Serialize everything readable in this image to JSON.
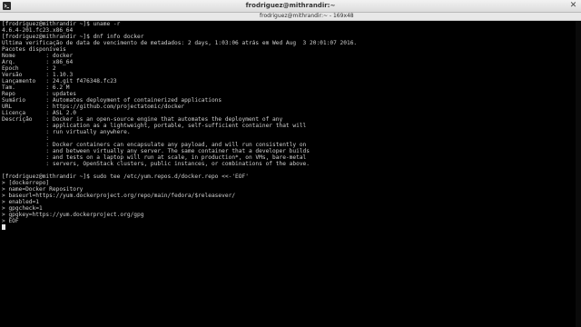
{
  "window": {
    "title": "frodriguez@mithrandir:~",
    "tab_title": "frodriguez@mithrandir:~ - 169x48",
    "close_icon": "close-icon",
    "app_icon": "terminal-icon"
  },
  "terminal": {
    "lines": [
      "[frodriguez@mithrandir ~]$ uname -r",
      "4.6.4-201.fc23.x86_64",
      "[frodriguez@mithrandir ~]$ dnf info docker",
      "Última verificação de data de vencimento de metadados: 2 days, 1:03:06 atrás em Wed Aug  3 20:01:07 2016.",
      "Pacotes disponíveis",
      "Nome         : docker",
      "Arq.         : x86_64",
      "Epoch        : 2",
      "Versão       : 1.10.3",
      "Lançamento   : 24.git f476348.fc23",
      "Tam.         : 6.2 M",
      "Repo         : updates",
      "Sumário      : Automates deployment of containerized applications",
      "URL          : https://github.com/projectatomic/docker",
      "Licença      : ASL 2.0",
      "Descrição    : Docker is an open-source engine that automates the deployment of any",
      "             : application as a lightweight, portable, self-sufficient container that will",
      "             : run virtually anywhere.",
      "             :",
      "             : Docker containers can encapsulate any payload, and will run consistently on",
      "             : and between virtually any server. The same container that a developer builds",
      "             : and tests on a laptop will run at scale, in production*, on VMs, bare-metal",
      "             : servers, OpenStack clusters, public instances, or combinations of the above.",
      "",
      "[frodriguez@mithrandir ~]$ sudo tee /etc/yum.repos.d/docker.repo <<-'EOF'",
      "> [dockerrepo]",
      "> name=Docker Repository",
      "> baseurl=https://yum.dockerproject.org/repo/main/fedora/$releasever/",
      "> enabled=1",
      "> gpgcheck=1",
      "> gpgkey=https://yum.dockerproject.org/gpg",
      "> EOF"
    ]
  }
}
